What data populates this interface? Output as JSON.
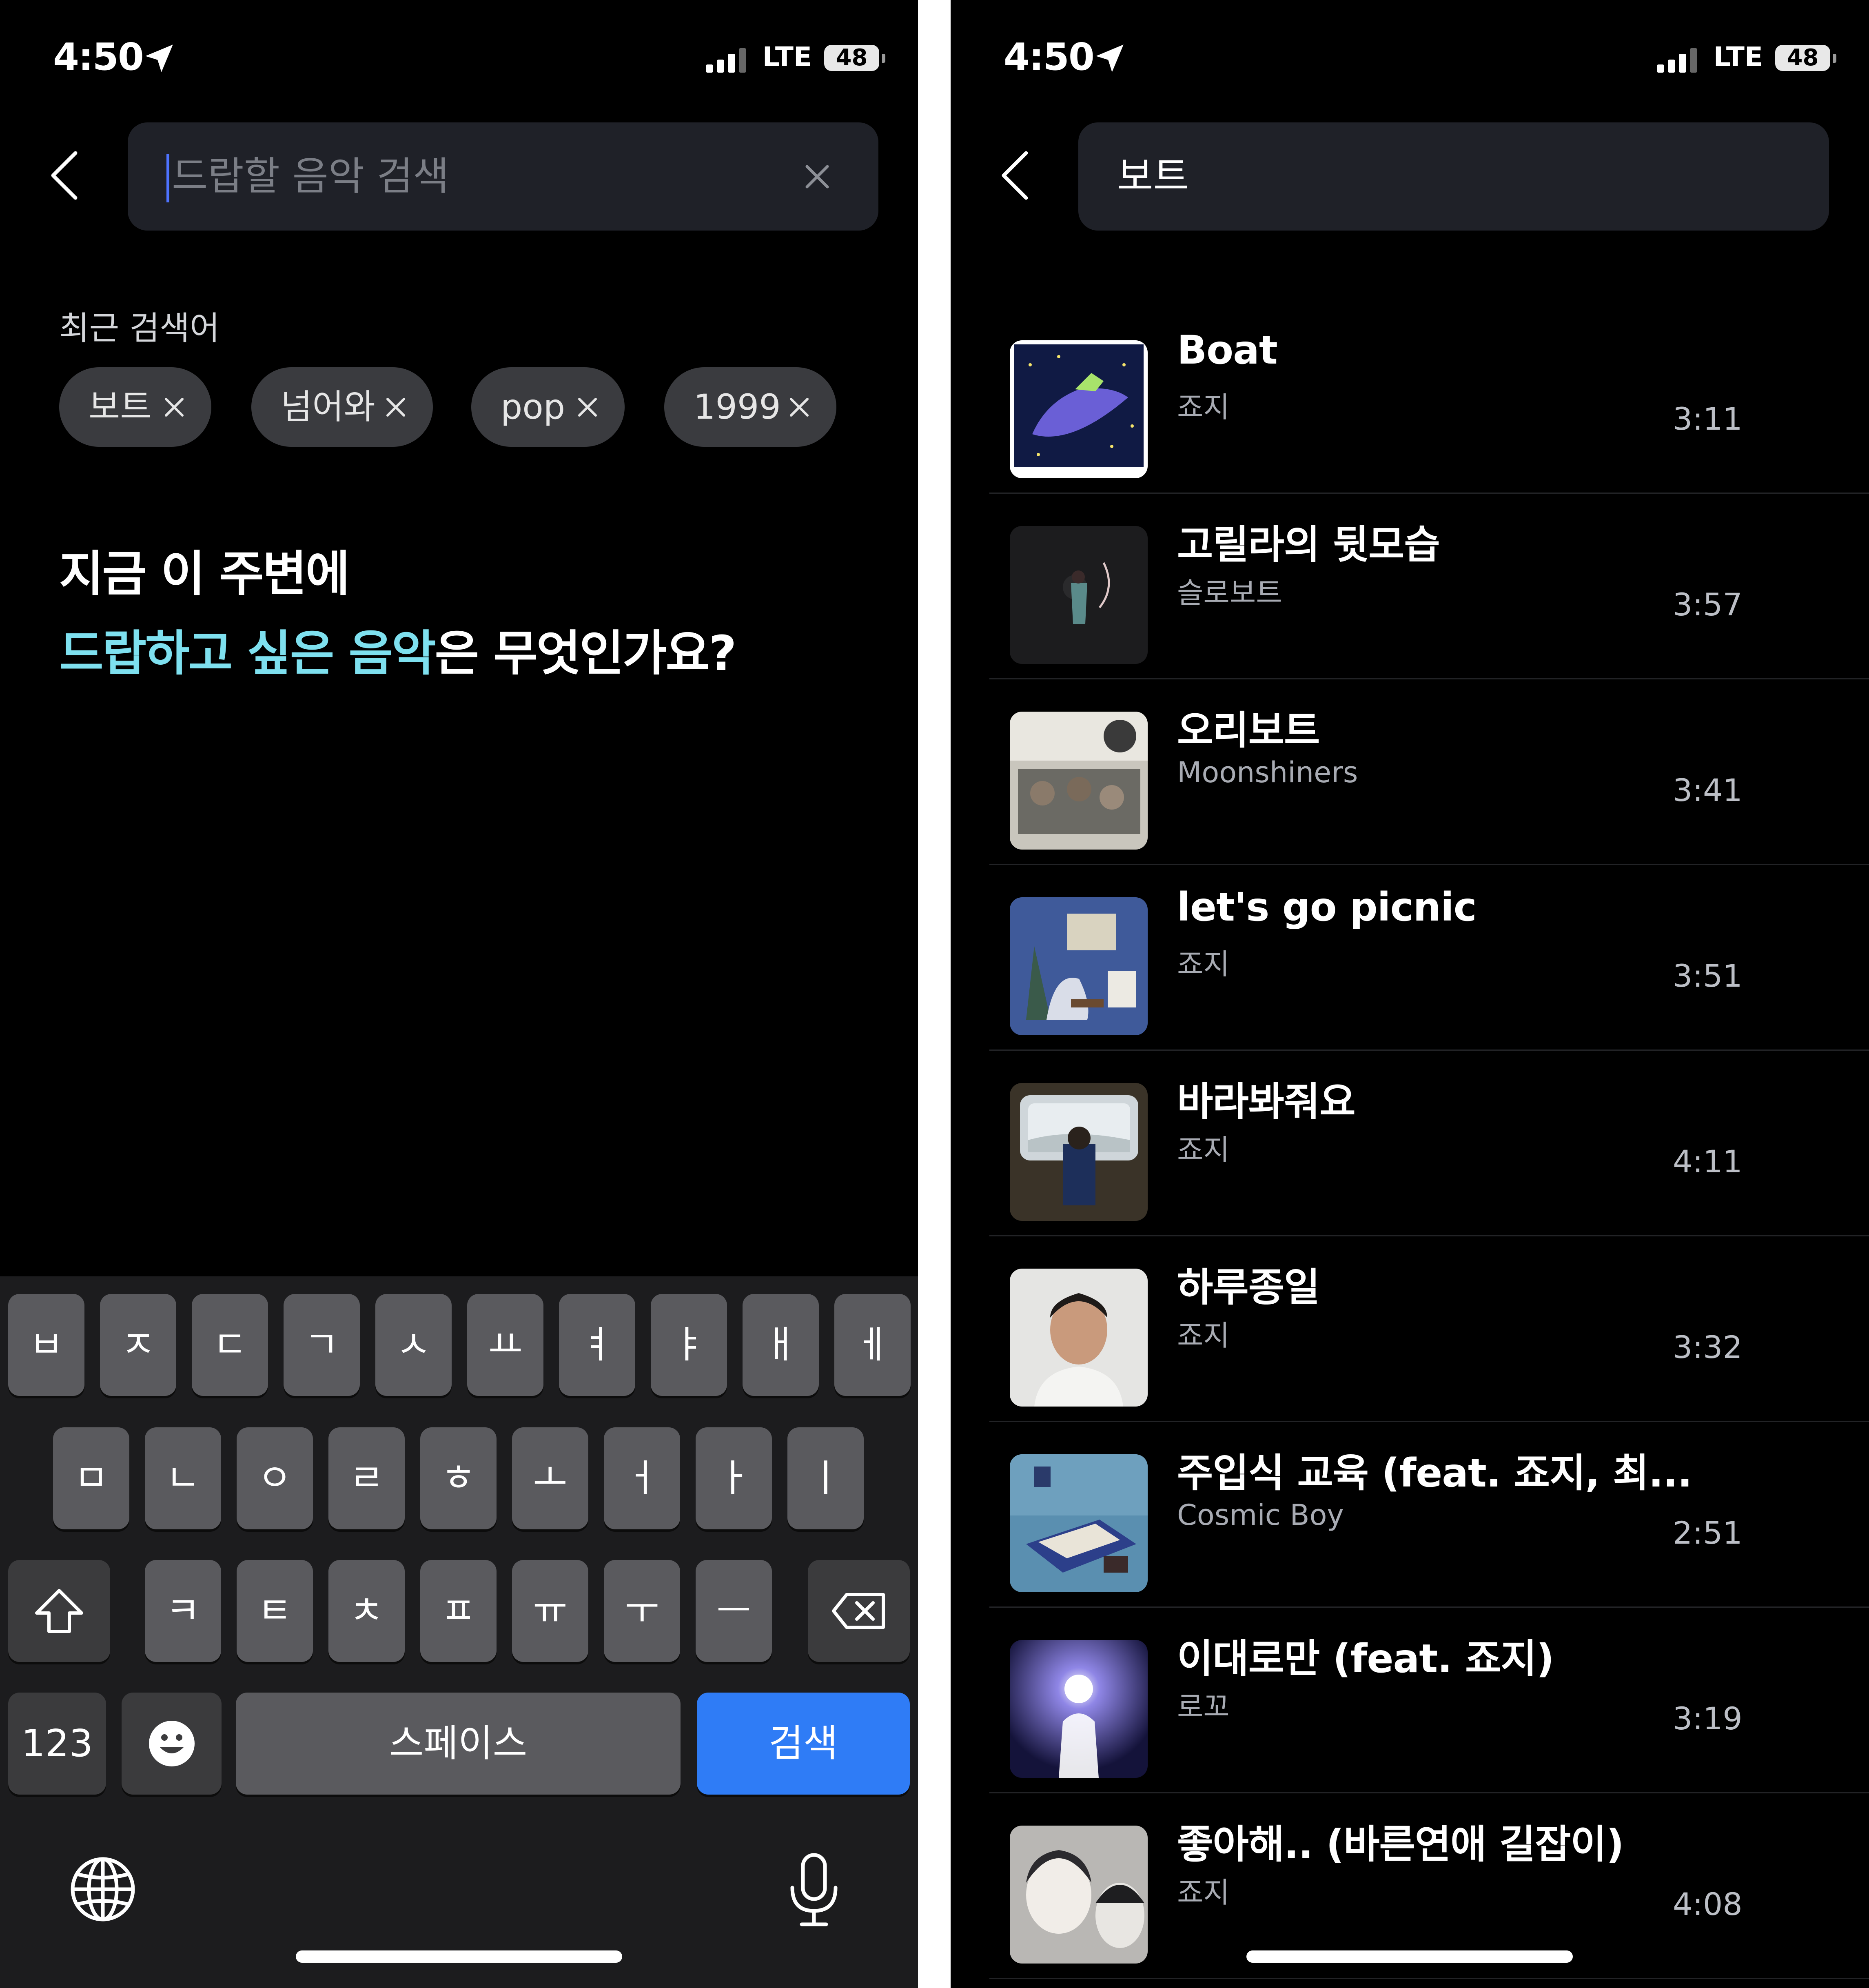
{
  "status_bar": {
    "time": "4:50",
    "network": "LTE",
    "battery": "48",
    "icons": [
      "location-arrow-icon",
      "signal-bars-icon",
      "battery-icon"
    ]
  },
  "left": {
    "search": {
      "placeholder": "드랍할 음악 검색"
    },
    "recent_title": "최근 검색어",
    "recent_chips": [
      "보트",
      "넘어와",
      "pop",
      "1999"
    ],
    "prompt": {
      "line1": "지금 이 주변에",
      "line2_part1": "드랍하고 싶은 음악",
      "line2_part2": "은 무엇인가요?"
    },
    "keyboard": {
      "row1": [
        "ㅂ",
        "ㅈ",
        "ㄷ",
        "ㄱ",
        "ㅅ",
        "ㅛ",
        "ㅕ",
        "ㅑ",
        "ㅐ",
        "ㅔ"
      ],
      "row2": [
        "ㅁ",
        "ㄴ",
        "ㅇ",
        "ㄹ",
        "ㅎ",
        "ㅗ",
        "ㅓ",
        "ㅏ",
        "ㅣ"
      ],
      "row3": [
        "ㅋ",
        "ㅌ",
        "ㅊ",
        "ㅍ",
        "ㅠ",
        "ㅜ",
        "ㅡ"
      ],
      "numbers_label": "123",
      "space_label": "스페이스",
      "search_label": "검색"
    }
  },
  "right": {
    "search": {
      "query": "보트"
    },
    "results": [
      {
        "title": "Boat",
        "artist": "죠지",
        "duration": "3:11"
      },
      {
        "title": "고릴라의 뒷모습",
        "artist": "슬로보트",
        "duration": "3:57"
      },
      {
        "title": "오리보트",
        "artist": "Moonshiners",
        "duration": "3:41"
      },
      {
        "title": "let's go picnic",
        "artist": "죠지",
        "duration": "3:51"
      },
      {
        "title": "바라봐줘요",
        "artist": "죠지",
        "duration": "4:11"
      },
      {
        "title": "하루종일",
        "artist": "죠지",
        "duration": "3:32"
      },
      {
        "title": "주입식 교육 (feat. 죠지, 최...",
        "artist": "Cosmic Boy",
        "duration": "2:51"
      },
      {
        "title": "이대로만 (feat. 죠지)",
        "artist": "로꼬",
        "duration": "3:19"
      },
      {
        "title": "좋아해.. (바른연애 길잡이)",
        "artist": "죠지",
        "duration": "4:08"
      }
    ]
  },
  "colors": {
    "accent_text": "#7ee0ef",
    "search_button": "#2f7cf6",
    "cursor": "#4e73ff",
    "background": "#000000"
  }
}
